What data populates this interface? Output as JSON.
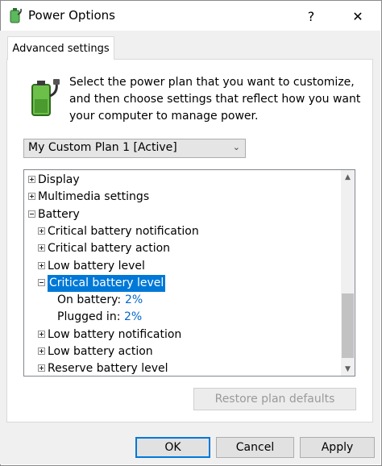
{
  "window": {
    "title": "Power Options",
    "help_glyph": "?",
    "close_glyph": "✕"
  },
  "tab": {
    "label": "Advanced settings"
  },
  "intro": "Select the power plan that you want to customize, and then choose settings that reflect how you want your computer to manage power.",
  "plan_select": {
    "value": "My Custom Plan 1 [Active]",
    "arrow": "⌄"
  },
  "tree": {
    "rows": [
      {
        "text": "Display",
        "expander": "plus"
      },
      {
        "text": "Multimedia settings",
        "expander": "plus"
      },
      {
        "text": "Battery",
        "expander": "minus"
      },
      {
        "text": "Critical battery notification",
        "expander": "plus"
      },
      {
        "text": "Critical battery action",
        "expander": "plus"
      },
      {
        "text": "Low battery level",
        "expander": "plus"
      },
      {
        "text": "Critical battery level",
        "expander": "minus",
        "selected": true
      },
      {
        "text": "On battery:",
        "value": "2%"
      },
      {
        "text": "Plugged in:",
        "value": "2%"
      },
      {
        "text": "Low battery notification",
        "expander": "plus"
      },
      {
        "text": "Low battery action",
        "expander": "plus"
      },
      {
        "text": "Reserve battery level",
        "expander": "plus"
      }
    ]
  },
  "scrollbar": {
    "up_glyph": "▲",
    "down_glyph": "▼"
  },
  "buttons": {
    "restore": "Restore plan defaults",
    "ok": "OK",
    "cancel": "Cancel",
    "apply": "Apply"
  },
  "icons": {
    "app": "power-options-icon",
    "battery": "battery-plug-icon"
  },
  "colors": {
    "accent": "#0078d7",
    "value_link": "#0066cc"
  }
}
